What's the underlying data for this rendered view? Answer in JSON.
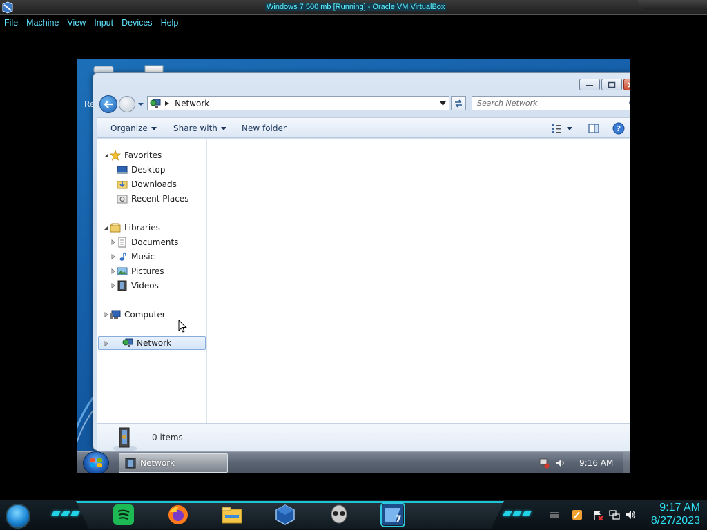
{
  "host": {
    "title": "Windows 7 500 mb [Running] - Oracle VM VirtualBox",
    "menu": [
      "File",
      "Machine",
      "View",
      "Input",
      "Devices",
      "Help"
    ],
    "clock_time": "9:17 AM",
    "clock_date": "8/27/2023",
    "apps": [
      "spotify-icon",
      "firefox-icon",
      "file-explorer-icon",
      "virtualbox-icon",
      "alienware-icon",
      "windows7-app-icon"
    ],
    "accent_color": "#22d3e8"
  },
  "guest": {
    "desktop_label_fragment": "Re",
    "explorer": {
      "address": "Network",
      "search_placeholder": "Search Network",
      "commands": {
        "organize": "Organize",
        "share_with": "Share with",
        "new_folder": "New folder"
      },
      "nav": {
        "favorites": "Favorites",
        "desktop": "Desktop",
        "downloads": "Downloads",
        "recent_places": "Recent Places",
        "libraries": "Libraries",
        "documents": "Documents",
        "music": "Music",
        "pictures": "Pictures",
        "videos": "Videos",
        "computer": "Computer",
        "network": "Network"
      },
      "status": "0 items"
    },
    "taskbar": {
      "task_label": "Network",
      "clock": "9:16 AM"
    }
  }
}
